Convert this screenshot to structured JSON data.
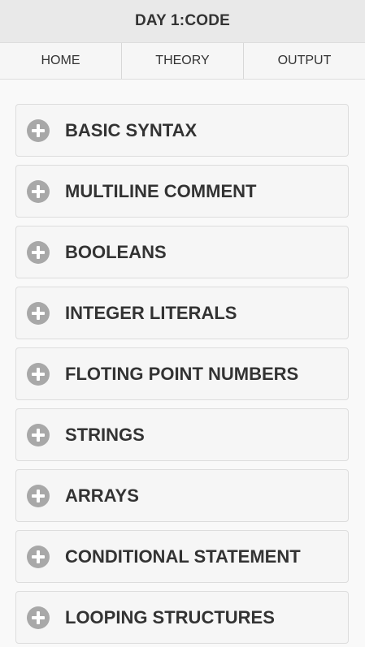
{
  "header": {
    "title": "DAY 1:CODE"
  },
  "nav": {
    "tabs": [
      {
        "label": "HOME"
      },
      {
        "label": "THEORY"
      },
      {
        "label": "OUTPUT"
      }
    ]
  },
  "sections": [
    {
      "label": "BASIC SYNTAX",
      "icon": "plus-circle-icon"
    },
    {
      "label": "MULTILINE COMMENT",
      "icon": "plus-circle-icon"
    },
    {
      "label": "BOOLEANS",
      "icon": "plus-circle-icon"
    },
    {
      "label": "INTEGER LITERALS",
      "icon": "plus-circle-icon"
    },
    {
      "label": "FLOTING POINT NUMBERS",
      "icon": "plus-circle-icon"
    },
    {
      "label": "STRINGS",
      "icon": "plus-circle-icon"
    },
    {
      "label": "ARRAYS",
      "icon": "plus-circle-icon"
    },
    {
      "label": "CONDITIONAL STATEMENT",
      "icon": "plus-circle-icon"
    },
    {
      "label": "LOOPING STRUCTURES",
      "icon": "plus-circle-icon"
    }
  ],
  "colors": {
    "header_bg": "#e9e9e9",
    "item_bg": "#f6f6f6",
    "icon_bg": "#a8a8a8",
    "text": "#333333"
  }
}
